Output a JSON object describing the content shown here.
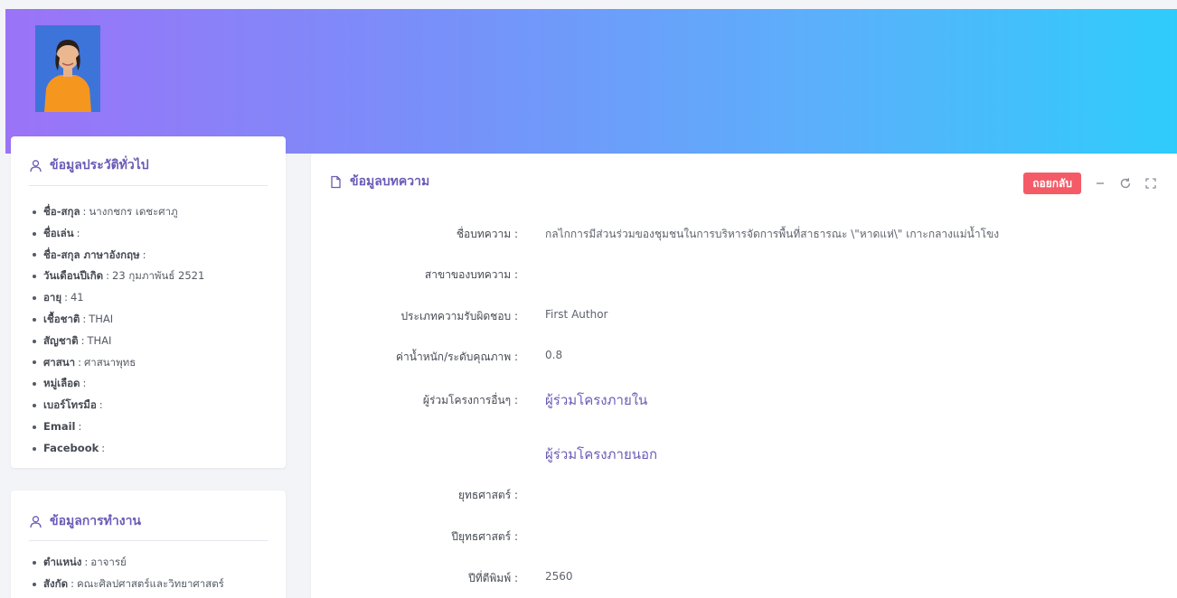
{
  "profile": {
    "photo_alt": ""
  },
  "general_info": {
    "title": "ข้อมูลประวัติทั่วไป",
    "icon": "user-icon",
    "items": [
      {
        "label": "ชื่อ-สกุล",
        "value": "นางกชกร เดชะศาภู"
      },
      {
        "label": "ชื่อเล่น",
        "value": ""
      },
      {
        "label": "ชื่อ-สกุล ภาษาอังกฤษ",
        "value": ""
      },
      {
        "label": "วันเดือนปีเกิด",
        "value": "23 กุมภาพันธ์ 2521"
      },
      {
        "label": "อายุ",
        "value": "41"
      },
      {
        "label": "เชื้อชาติ",
        "value": "THAI"
      },
      {
        "label": "สัญชาติ",
        "value": "THAI"
      },
      {
        "label": "ศาสนา",
        "value": "ศาสนาพุทธ"
      },
      {
        "label": "หมู่เลือด",
        "value": ""
      },
      {
        "label": "เบอร์โทรมือ",
        "value": ""
      },
      {
        "label": "Email",
        "value": ""
      },
      {
        "label": "Facebook",
        "value": ""
      }
    ]
  },
  "work_info": {
    "title": "ข้อมูลการทำงาน",
    "icon": "user-icon",
    "items": [
      {
        "label": "ตำแหน่ง",
        "value": "อาจารย์"
      },
      {
        "label": "สังกัด",
        "value": "คณะศิลปศาสตร์และวิทยาศาสตร์"
      }
    ]
  },
  "article": {
    "title": "ข้อมูลบทความ",
    "icon": "file-icon",
    "back_label": "ถอยกลับ",
    "fields": [
      {
        "label": "ชื่อบทความ :",
        "value": "กลไกการมีส่วนร่วมของชุมชนในการบริหารจัดการพื้นที่สาธารณะ \\\"หาดแห่\\\" เกาะกลางแม่น้ำโขง"
      },
      {
        "label": "สาขาของบทความ :",
        "value": ""
      },
      {
        "label": "ประเภทความรับผิดชอบ :",
        "value": "First Author"
      },
      {
        "label": "ค่าน้ำหนัก/ระดับคุณภาพ :",
        "value": "0.8"
      },
      {
        "label": "ผู้ร่วมโครงการอื่นๆ :",
        "value": ""
      },
      {
        "label": "ยุทธศาสตร์ :",
        "value": ""
      },
      {
        "label": "ปียุทธศาสตร์ :",
        "value": ""
      },
      {
        "label": "ปีที่ตีพิมพ์ :",
        "value": "2560"
      }
    ],
    "coop_internal": "ผู้ร่วมโครงภายใน",
    "coop_external": "ผู้ร่วมโครงภายนอก"
  }
}
